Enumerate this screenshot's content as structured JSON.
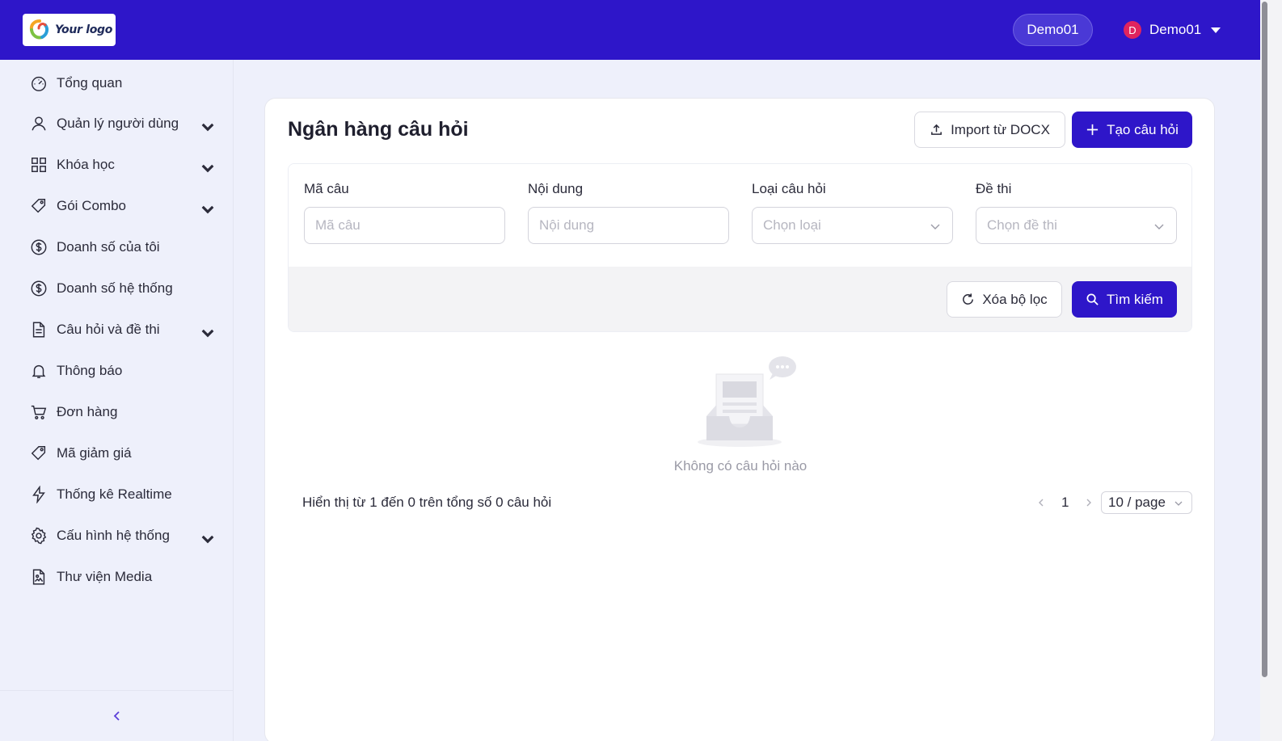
{
  "header": {
    "logo_text": "Your logo",
    "pill_label": "Demo01",
    "user_initial": "D",
    "user_name": "Demo01"
  },
  "sidebar": {
    "items": [
      {
        "label": "Tổng quan",
        "icon": "dashboard-icon",
        "expandable": false
      },
      {
        "label": "Quản lý người dùng",
        "icon": "user-icon",
        "expandable": true
      },
      {
        "label": "Khóa học",
        "icon": "grid-icon",
        "expandable": true
      },
      {
        "label": "Gói Combo",
        "icon": "tag-icon",
        "expandable": true
      },
      {
        "label": "Doanh số của tôi",
        "icon": "dollar-icon",
        "expandable": false
      },
      {
        "label": "Doanh số hệ thống",
        "icon": "dollar-icon",
        "expandable": false
      },
      {
        "label": "Câu hỏi và đề thi",
        "icon": "document-icon",
        "expandable": true
      },
      {
        "label": "Thông báo",
        "icon": "bell-icon",
        "expandable": false
      },
      {
        "label": "Đơn hàng",
        "icon": "cart-icon",
        "expandable": false
      },
      {
        "label": "Mã giảm giá",
        "icon": "tag-icon",
        "expandable": false
      },
      {
        "label": "Thống kê Realtime",
        "icon": "lightning-icon",
        "expandable": false
      },
      {
        "label": "Cấu hình hệ thống",
        "icon": "gear-icon",
        "expandable": true
      },
      {
        "label": "Thư viện Media",
        "icon": "image-file-icon",
        "expandable": false
      }
    ],
    "collapse_icon": "chevron-left-icon"
  },
  "main": {
    "title": "Ngân hàng câu hỏi",
    "import_label": "Import từ DOCX",
    "create_label": "Tạo câu hỏi",
    "filters": {
      "code_label": "Mã câu",
      "code_placeholder": "Mã câu",
      "content_label": "Nội dung",
      "content_placeholder": "Nội dung",
      "type_label": "Loại câu hỏi",
      "type_placeholder": "Chọn loại",
      "exam_label": "Đề thi",
      "exam_placeholder": "Chọn đề thi"
    },
    "clear_label": "Xóa bộ lọc",
    "search_label": "Tìm kiếm",
    "empty_text": "Không có câu hỏi nào",
    "summary_text": "Hiển thị từ 1 đến 0 trên tổng số 0 câu hỏi",
    "pagination": {
      "current_page": "1",
      "page_size": "10 / page"
    }
  },
  "colors": {
    "accent": "#2e16c9",
    "background": "#eef0fb"
  }
}
